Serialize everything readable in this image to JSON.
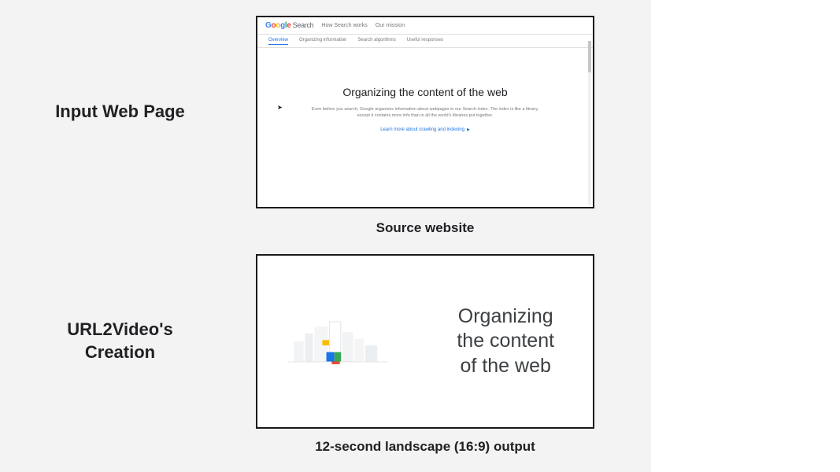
{
  "labels": {
    "row1": "Input Web Page",
    "row2_line1": "URL2Video's",
    "row2_line2": "Creation"
  },
  "captions": {
    "panel1": "Source website",
    "panel2": "12-second landscape (16:9) output"
  },
  "mini_page": {
    "logo_text": "Google",
    "logo_suffix": "Search",
    "nav1": "How Search works",
    "nav2": "Our mission",
    "tabs": {
      "t1": "Overview",
      "t2": "Organizing information",
      "t3": "Search algorithms",
      "t4": "Useful responses"
    },
    "title": "Organizing the content of the web",
    "desc": "Even before you search, Google organizes information about webpages in our Search index. The index is like a library, except it contains more info than in all the world's libraries put together.",
    "link": "Learn more about crawling and indexing"
  },
  "panel2": {
    "line1": "Organizing",
    "line2": "the content",
    "line3": "of the web"
  }
}
